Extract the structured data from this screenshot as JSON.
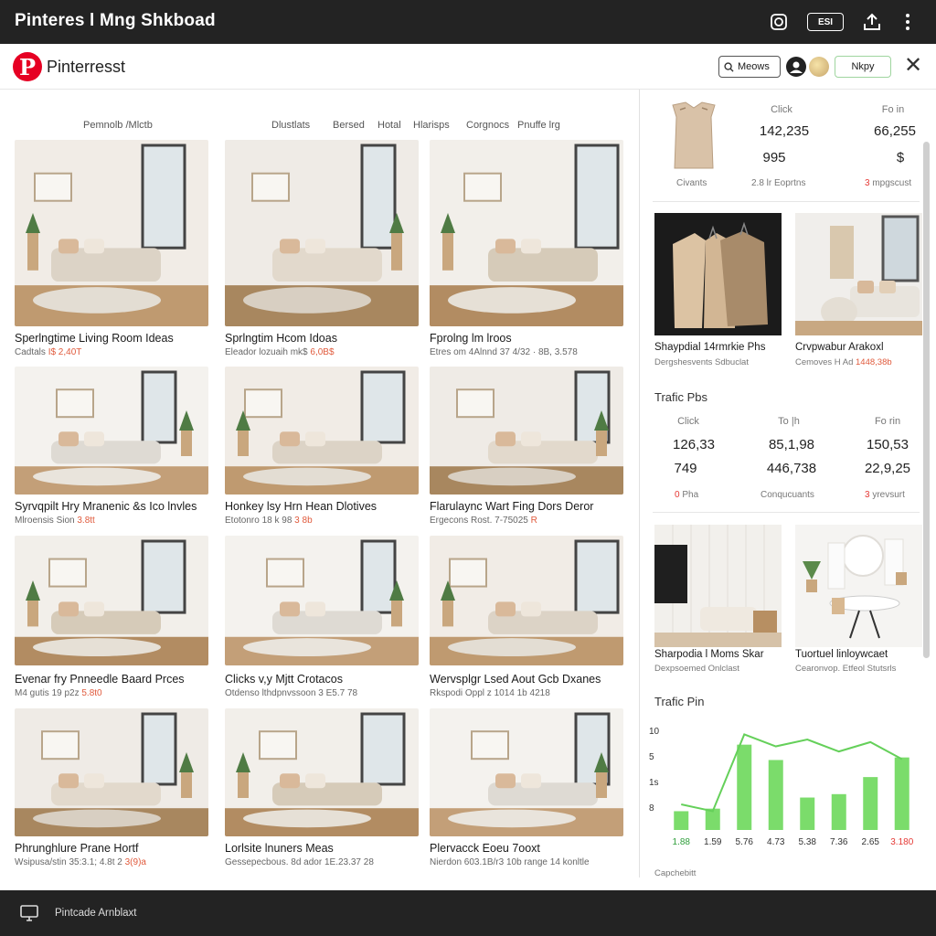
{
  "window": {
    "title": "Pinteres l Mng Shkboad",
    "badge": "ESI"
  },
  "app": {
    "brand": "Pinterresst",
    "logo_letter": "P",
    "search_label": "Meows",
    "action_label": "Nkpy"
  },
  "filters": [
    "Pemnolb /Mlctb",
    "Dlustlats",
    "Bersed",
    "Hotal",
    "Hlarisps",
    "Corgnocs",
    "Pnuffe lrg"
  ],
  "cards": [
    {
      "title": "Sperlngtime Living Room Ideas",
      "meta": "Cadtals",
      "meta2": "I$ 2,40T"
    },
    {
      "title": "Sprlngtim Hcom Idoas",
      "meta": "Eleador lozuaih mk$",
      "meta2": "6,0B$"
    },
    {
      "title": "Fprolng lm lroos",
      "meta": "Etres om 4Alnnd 37 4/32 · 8B, 3.578",
      "meta2": ""
    },
    {
      "title": "Syrvqpilt Hry Mranenic &s Ico lnvles",
      "meta": "Mlroensis Sion",
      "meta2": "3.8tt"
    },
    {
      "title": "Honkey lsy Hrn Hean Dlotives",
      "meta": "Etotonro 18 k 98",
      "meta2": "3 8b"
    },
    {
      "title": "Flarulaync Wart Fing Dors Deror",
      "meta": "Ergecons Rost. 7-75025",
      "meta2": "R"
    },
    {
      "title": "Evenar fry Pnneedle Baard Prces",
      "meta": "M4 gutis 19 p2z",
      "meta2": "5.8t0"
    },
    {
      "title": "Clicks v,y Mjtt Crotacos",
      "meta": "Otdenso lthdpnvssoon 3 E5.7 78",
      "meta2": ""
    },
    {
      "title": "Wervsplgr Lsed Aout Gcb Dxanes",
      "meta": "Rkspodi Oppl z 1014 1b 4218",
      "meta2": ""
    },
    {
      "title": "Phrunghlure Prane Hortf",
      "meta": "Wsipusa/stin 35:3.1; 4.8t 2",
      "meta2": "3(9)a"
    },
    {
      "title": "Lorlsite lnuners Meas",
      "meta": "Gessepecbous. 8d ador 1E.23.37 28",
      "meta2": ""
    },
    {
      "title": "Plervacck Eoeu 7ooxt",
      "meta": "Nierdon 603.1B/r3 10b range 14 konltle",
      "meta2": ""
    }
  ],
  "right_panel": {
    "top_stats": {
      "col1_label": "Click",
      "col2_label": "Fo in",
      "v1": "142,235",
      "v2": "66,255",
      "v3": "995",
      "v4": "$",
      "sub1": "Civants",
      "sub2": "2.8 lr Eoprtns",
      "sub3_num": "3",
      "sub3": "mpgscust"
    },
    "pins_a": [
      {
        "title": "Shaypdial 14rmrkie Phs",
        "meta": "Dergshesvents Sdbuclat"
      },
      {
        "title": "Crvpwabur Arakoxl",
        "meta": "Cemoves H Ad",
        "meta_hl": "1448,38b"
      }
    ],
    "traffic_title": "Trafic Pbs",
    "traffic": {
      "headers": [
        "Click",
        "To |h",
        "Fo rin"
      ],
      "row1": [
        "126,33",
        "85,1,98",
        "150,53"
      ],
      "row2": [
        "749",
        "446,738",
        "22,9,25"
      ],
      "foot1": "Pha",
      "foot1_num": "0",
      "foot2": "Conqucuants",
      "foot3_num": "3",
      "foot3": "yrevsurt"
    },
    "pins_b": [
      {
        "title": "Sharpodia l Moms Skar",
        "meta": "Dexpsoemed Onlclast"
      },
      {
        "title": "Tuortuel linloywcaet",
        "meta": "Cearonvop. Etfeol Stutsrls"
      }
    ],
    "chart_title": "Trafic Pin",
    "chart_footer": "Capchebitt"
  },
  "chart_data": {
    "type": "bar",
    "title": "Trafic Pin",
    "y_ticks": [
      "10",
      "5",
      "1s",
      "8"
    ],
    "categories": [
      "1.88",
      "1.59",
      "5.76",
      "4.73",
      "5.38",
      "7.36",
      "2.65",
      "3.180"
    ],
    "values": [
      2.2,
      2.5,
      10,
      8.2,
      3.8,
      4.2,
      6.2,
      8.5
    ],
    "line_values": [
      3.0,
      2.2,
      11.2,
      9.8,
      10.6,
      9.2,
      10.3,
      8.3
    ],
    "ylim": [
      0,
      12
    ],
    "bar_color": "#7bdc6b",
    "line_color": "#65d05a",
    "highlight_label_color": "#e53935"
  },
  "footer": {
    "text": "Pintcade Arnblaxt"
  }
}
